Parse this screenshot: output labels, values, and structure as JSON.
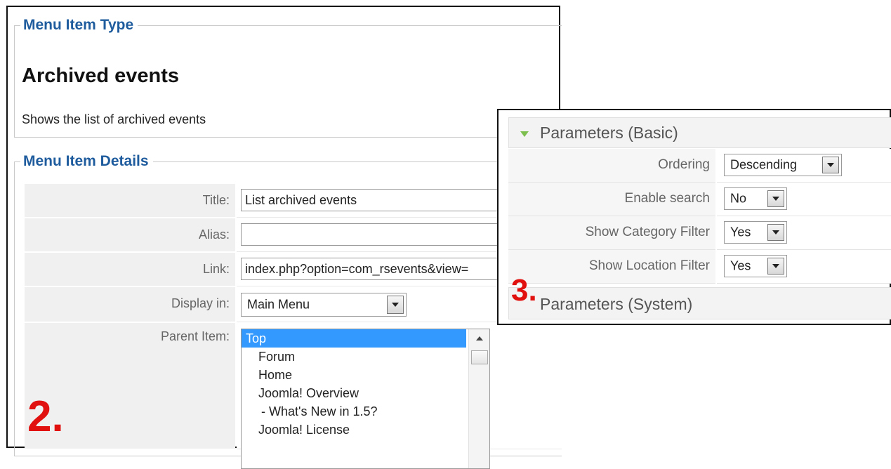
{
  "menu_item_type": {
    "legend": "Menu Item Type",
    "title": "Archived events",
    "description": "Shows the list of archived events"
  },
  "menu_item_details": {
    "legend": "Menu Item Details",
    "title_label": "Title:",
    "title_value": "List archived events",
    "alias_label": "Alias:",
    "alias_value": "",
    "link_label": "Link:",
    "link_value": "index.php?option=com_rsevents&view=",
    "display_label": "Display in:",
    "display_value": "Main Menu",
    "parent_label": "Parent Item:",
    "parent_items": [
      "Top",
      "Forum",
      "Home",
      "Joomla! Overview",
      " - What's New in 1.5?",
      "Joomla! License"
    ]
  },
  "step_numbers": {
    "left": "2.",
    "right": "3."
  },
  "parameters_basic": {
    "title": "Parameters (Basic)",
    "rows": [
      {
        "label": "Ordering",
        "value": "Descending"
      },
      {
        "label": "Enable search",
        "value": "No"
      },
      {
        "label": "Show Category Filter",
        "value": "Yes"
      },
      {
        "label": "Show Location Filter",
        "value": "Yes"
      }
    ]
  },
  "parameters_system": {
    "title": "Parameters (System)"
  },
  "colors": {
    "legend_blue": "#1f5c9e",
    "step_red": "#e0110f",
    "selected_blue": "#3399ff",
    "toggle_green": "#7cbf4f"
  }
}
